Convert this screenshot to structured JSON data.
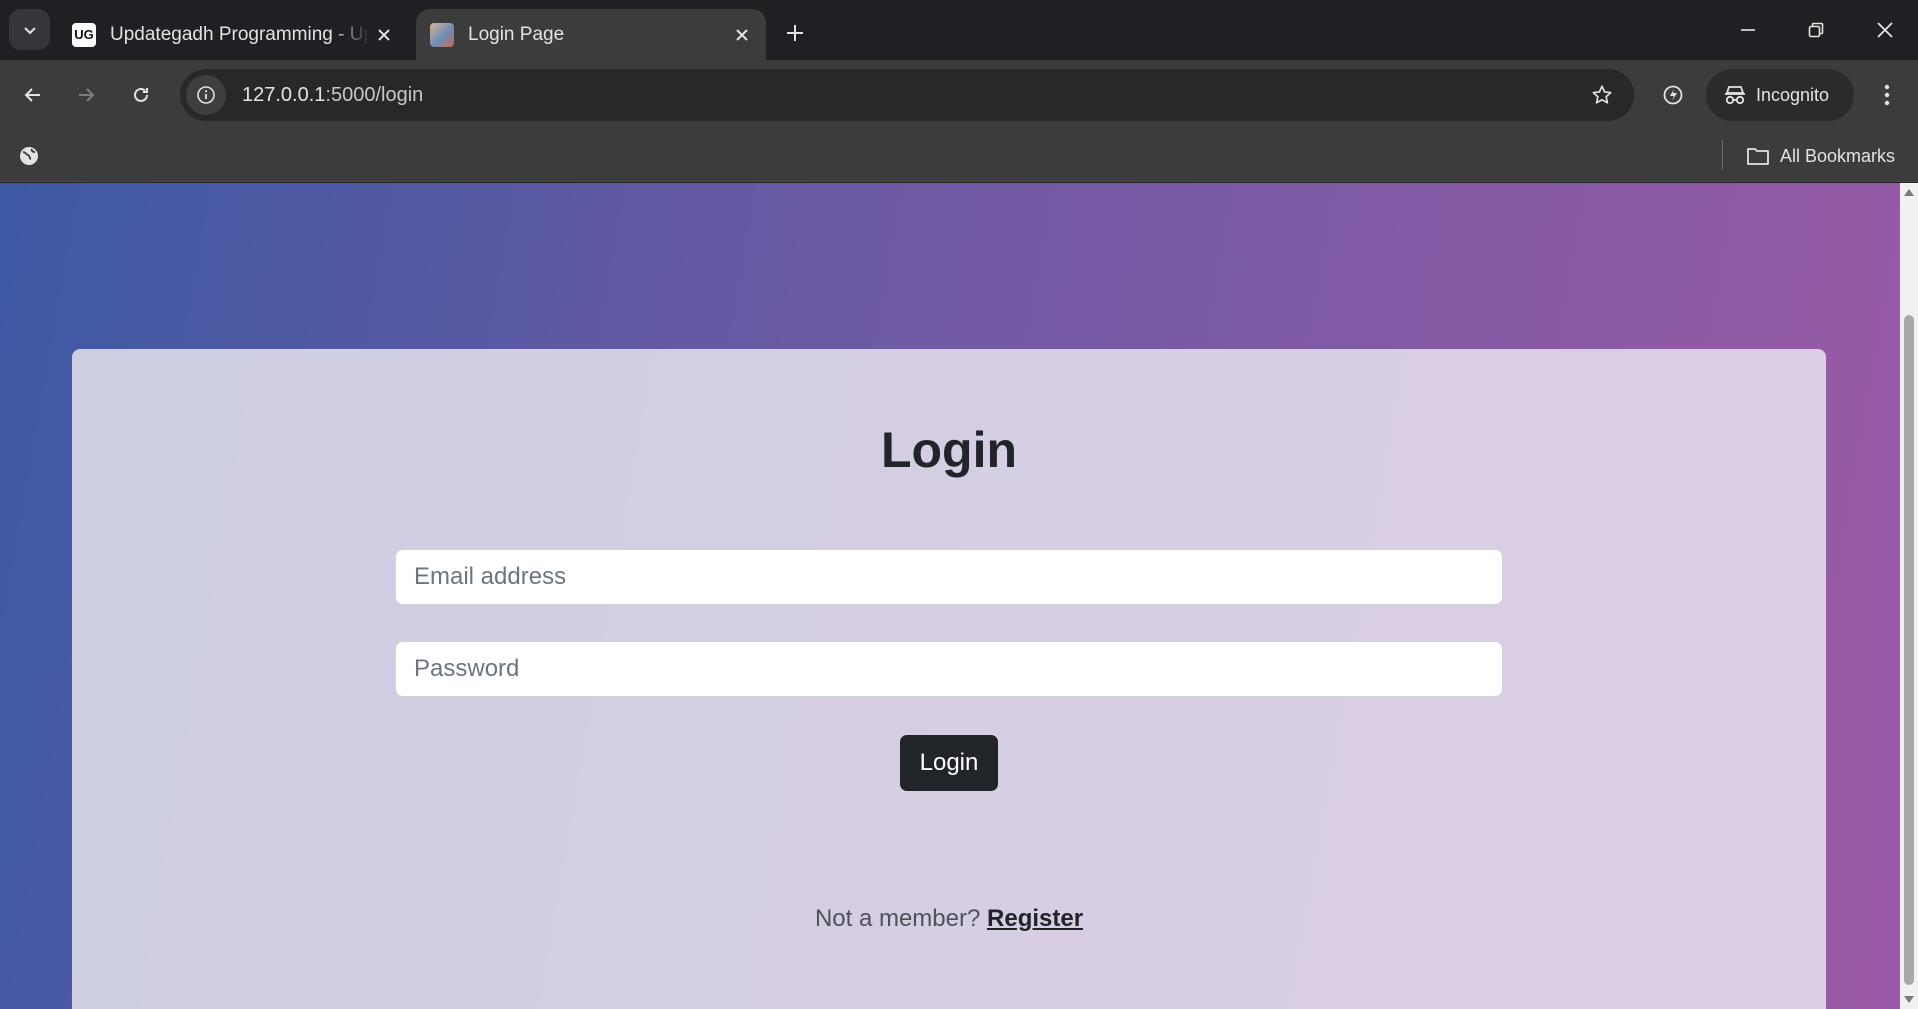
{
  "browser": {
    "tabs": [
      {
        "title": "Updategadh Programming - Up",
        "favicon_text": "UG",
        "active": false
      },
      {
        "title": "Login Page",
        "active": true
      }
    ],
    "url": {
      "host": "127.0.0.1",
      "path": ":5000/login"
    },
    "profile_label": "Incognito",
    "bookmarks_label": "All Bookmarks"
  },
  "page": {
    "heading": "Login",
    "email_placeholder": "Email address",
    "password_placeholder": "Password",
    "login_button": "Login",
    "register_prompt": "Not a member?",
    "register_link": "Register"
  },
  "colors": {
    "gradient_start": "#3d59a3",
    "gradient_end": "#9b5aa7",
    "button": "#212529"
  }
}
